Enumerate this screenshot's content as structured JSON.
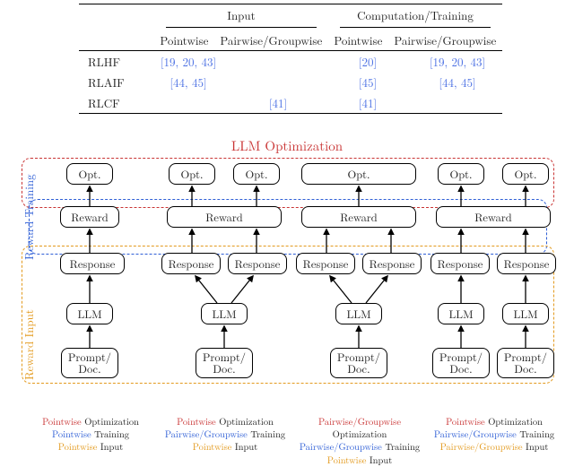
{
  "table": {
    "group_headers": {
      "input": "Input",
      "comp": "Computation/Training"
    },
    "sub_headers": {
      "pw": "Pointwise",
      "pg": "Pairwise/Groupwise"
    },
    "rows": {
      "rlhf": {
        "label": "RLHF",
        "input_pw": "[19, 20, 43]",
        "input_pg": "",
        "comp_pw": "[20]",
        "comp_pg": "[19, 20, 43]"
      },
      "rlaif": {
        "label": "RLAIF",
        "input_pw": "[44, 45]",
        "input_pg": "",
        "comp_pw": "[45]",
        "comp_pg": "[44, 45]"
      },
      "rlcf": {
        "label": "RLCF",
        "input_pw": "",
        "input_pg": "[41]",
        "comp_pw": "[41]",
        "comp_pg": ""
      }
    }
  },
  "diagram": {
    "title": "LLM Optimization",
    "side_labels": {
      "reward_training": "Reward Training",
      "reward_input": "Reward Input"
    },
    "nodes": {
      "opt": "Opt.",
      "reward": "Reward",
      "response": "Response",
      "llm": "LLM",
      "prompt_doc_l1": "Prompt/",
      "prompt_doc_l2": "Doc."
    },
    "captions": {
      "c1": {
        "opt_kind": "Pointwise",
        "train_kind": "Pointwise",
        "input_kind": "Pointwise"
      },
      "c2": {
        "opt_kind": "Pointwise",
        "train_kind": "Pairwise/Groupwise",
        "input_kind": "Pointwise"
      },
      "c3": {
        "opt_kind": "Pairwise/Groupwise",
        "train_kind": "Pairwise/Groupwise",
        "input_kind": "Pointwise"
      },
      "c4": {
        "opt_kind": "Pointwise",
        "train_kind": "Pairwise/Groupwise",
        "input_kind": "Pairwise/Groupwise"
      },
      "words": {
        "optimization": "Optimization",
        "training": "Training",
        "input": "Input"
      }
    }
  }
}
